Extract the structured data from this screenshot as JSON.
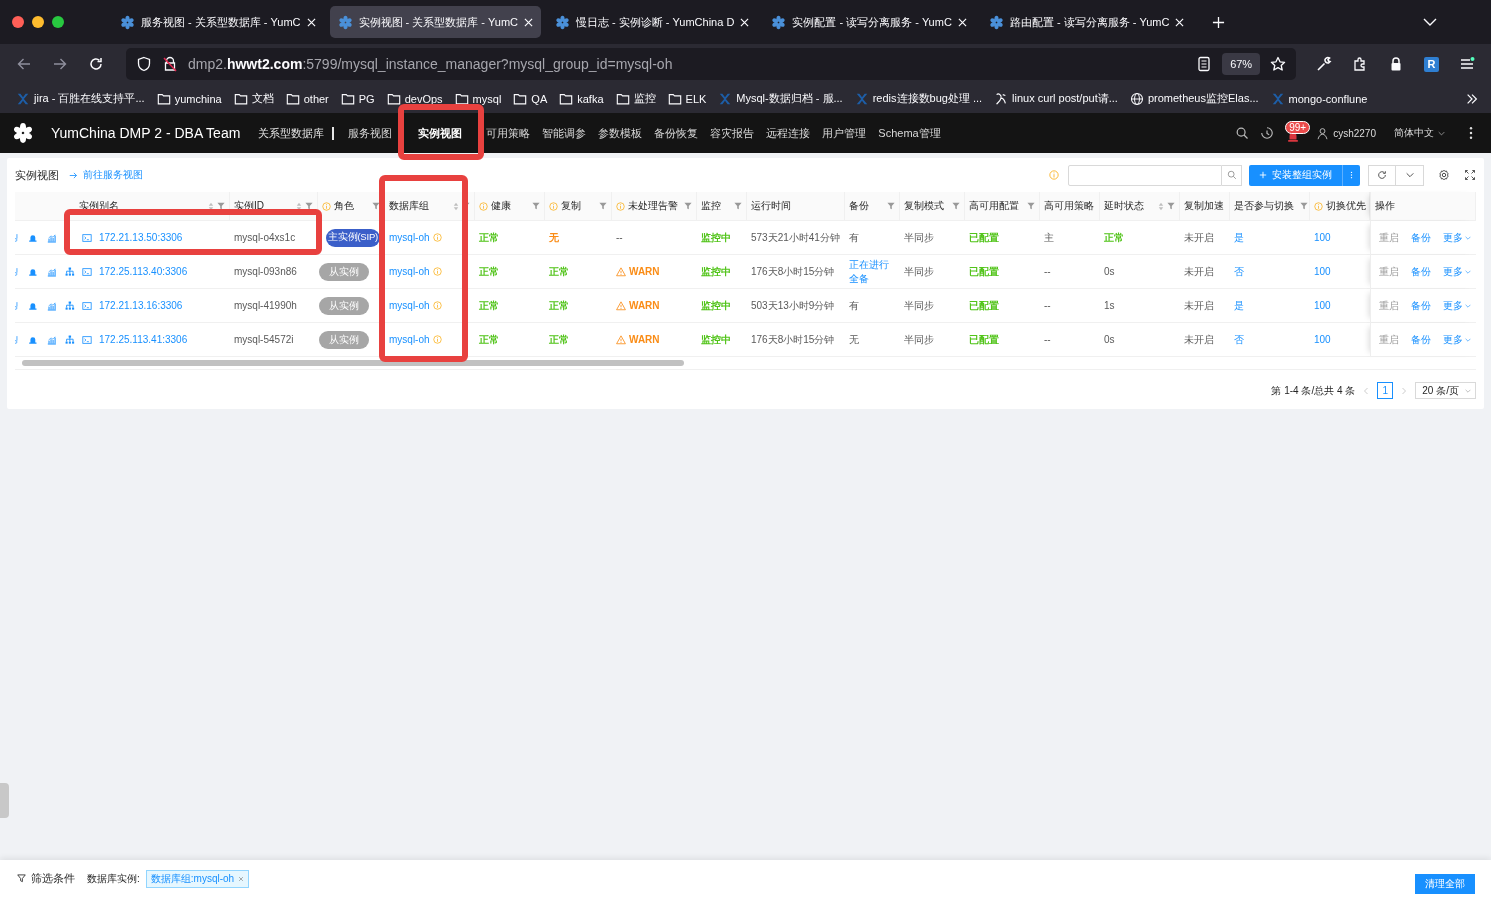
{
  "browser": {
    "tabs": [
      {
        "title": "服务视图 - 关系型数据库 - YumC",
        "selected": false
      },
      {
        "title": "实例视图 - 关系型数据库 - YumC",
        "selected": true
      },
      {
        "title": "慢日志 - 实例诊断 - YumChina D",
        "selected": false
      },
      {
        "title": "实例配置 - 读写分离服务 - YumC",
        "selected": false
      },
      {
        "title": "路由配置 - 读写分离服务 - YumC",
        "selected": false
      }
    ],
    "url": "dmp2.**hwwt2.com**:5799/mysql_instance_manager?mysql_group_id=mysql-oh",
    "zoom": "67%",
    "profile": "R",
    "bookmarks": [
      {
        "label": "jira - 百胜在线支持平...",
        "kind": "site"
      },
      {
        "label": "yumchina",
        "kind": "folder"
      },
      {
        "label": "文档",
        "kind": "folder"
      },
      {
        "label": "other",
        "kind": "folder"
      },
      {
        "label": "PG",
        "kind": "folder"
      },
      {
        "label": "devOps",
        "kind": "folder"
      },
      {
        "label": "mysql",
        "kind": "folder"
      },
      {
        "label": "QA",
        "kind": "folder"
      },
      {
        "label": "kafka",
        "kind": "folder"
      },
      {
        "label": "监控",
        "kind": "folder"
      },
      {
        "label": "ELK",
        "kind": "folder"
      },
      {
        "label": "Mysql-数据归档 - 服...",
        "kind": "site"
      },
      {
        "label": "redis连接数bug处理 ...",
        "kind": "site"
      },
      {
        "label": "linux curl post/put请...",
        "kind": "script"
      },
      {
        "label": "prometheus监控Elas...",
        "kind": "globe"
      },
      {
        "label": "mongo-conflune",
        "kind": "site"
      }
    ]
  },
  "app": {
    "title": "YumChina DMP 2 - DBA Team",
    "section": "关系型数据库",
    "nav": [
      {
        "label": "服务视图",
        "selected": false
      },
      {
        "label": "实例视图",
        "selected": true
      },
      {
        "label": "可用策略",
        "selected": false
      },
      {
        "label": "智能调参",
        "selected": false
      },
      {
        "label": "参数模板",
        "selected": false
      },
      {
        "label": "备份恢复",
        "selected": false
      },
      {
        "label": "容灾报告",
        "selected": false
      },
      {
        "label": "远程连接",
        "selected": false
      },
      {
        "label": "用户管理",
        "selected": false
      },
      {
        "label": "Schema管理",
        "selected": false
      }
    ],
    "notification_count": "99+",
    "user": "cysh2270",
    "language": "简体中文"
  },
  "page": {
    "title": "实例视图",
    "link": "前往服务视图",
    "primary_action": "安装整组实例"
  },
  "table": {
    "columns": [
      {
        "label": "实例别名",
        "sort": true,
        "filter": true,
        "info": false
      },
      {
        "label": "实例ID",
        "sort": true,
        "filter": true,
        "info": false
      },
      {
        "label": "角色",
        "sort": false,
        "filter": true,
        "info": true
      },
      {
        "label": "数据库组",
        "sort": true,
        "filter": true,
        "info": false
      },
      {
        "label": "健康",
        "sort": false,
        "filter": true,
        "info": true
      },
      {
        "label": "复制",
        "sort": false,
        "filter": true,
        "info": true
      },
      {
        "label": "未处理告警",
        "sort": false,
        "filter": true,
        "info": true
      },
      {
        "label": "监控",
        "sort": false,
        "filter": true,
        "info": false
      },
      {
        "label": "运行时间",
        "sort": false,
        "filter": false,
        "info": false
      },
      {
        "label": "备份",
        "sort": false,
        "filter": true,
        "info": false
      },
      {
        "label": "复制模式",
        "sort": false,
        "filter": true,
        "info": false
      },
      {
        "label": "高可用配置",
        "sort": false,
        "filter": true,
        "info": false
      },
      {
        "label": "高可用策略",
        "sort": false,
        "filter": false,
        "info": false
      },
      {
        "label": "延时状态",
        "sort": true,
        "filter": true,
        "info": false
      },
      {
        "label": "复制加速",
        "sort": false,
        "filter": false,
        "info": false
      },
      {
        "label": "是否参与切换",
        "sort": false,
        "filter": true,
        "info": false
      },
      {
        "label": "切换优先",
        "sort": false,
        "filter": false,
        "info": true
      },
      {
        "label": "操作",
        "sort": false,
        "filter": false,
        "info": false
      }
    ],
    "rows": [
      {
        "topology": false,
        "cells": [
          {
            "text": "172.21.13.50:3306",
            "kind": "address"
          },
          {
            "text": "mysql-o4xs1c",
            "kind": "plain"
          },
          {
            "text": "主实例(SIP)",
            "kind": "primary_role"
          },
          {
            "text": "mysql-oh",
            "kind": "group"
          },
          {
            "text": "正常",
            "kind": "ok"
          },
          {
            "text": "无",
            "kind": "warn"
          },
          {
            "text": "--",
            "kind": "plain"
          },
          {
            "text": "监控中",
            "kind": "ok"
          },
          {
            "text": "573天21小时41分钟",
            "kind": "plain"
          },
          {
            "text": "有",
            "kind": "plain"
          },
          {
            "text": "半同步",
            "kind": "plain"
          },
          {
            "text": "已配置",
            "kind": "ok"
          },
          {
            "text": "主",
            "kind": "plain"
          },
          {
            "text": "正常",
            "kind": "ok"
          },
          {
            "text": "未开启",
            "kind": "plain"
          },
          {
            "text": "是",
            "kind": "link"
          },
          {
            "text": "100",
            "kind": "link"
          }
        ],
        "actions": [
          {
            "label": "重启",
            "disabled": true,
            "menu": false
          },
          {
            "label": "备份",
            "disabled": false,
            "menu": false
          },
          {
            "label": "更多",
            "disabled": false,
            "menu": true
          }
        ]
      },
      {
        "topology": true,
        "cells": [
          {
            "text": "172.25.113.40:3306",
            "kind": "address"
          },
          {
            "text": "mysql-093n86",
            "kind": "plain"
          },
          {
            "text": "从实例",
            "kind": "role"
          },
          {
            "text": "mysql-oh",
            "kind": "group"
          },
          {
            "text": "正常",
            "kind": "ok"
          },
          {
            "text": "正常",
            "kind": "ok"
          },
          {
            "text": "WARN",
            "kind": "alert"
          },
          {
            "text": "监控中",
            "kind": "ok"
          },
          {
            "text": "176天8小时15分钟",
            "kind": "plain"
          },
          {
            "text": "正在进行全备",
            "kind": "link"
          },
          {
            "text": "半同步",
            "kind": "plain"
          },
          {
            "text": "已配置",
            "kind": "ok"
          },
          {
            "text": "--",
            "kind": "plain"
          },
          {
            "text": "0s",
            "kind": "plain"
          },
          {
            "text": "未开启",
            "kind": "plain"
          },
          {
            "text": "否",
            "kind": "link"
          },
          {
            "text": "100",
            "kind": "link"
          }
        ],
        "actions": [
          {
            "label": "重启",
            "disabled": true,
            "menu": false
          },
          {
            "label": "备份",
            "disabled": false,
            "menu": false
          },
          {
            "label": "更多",
            "disabled": false,
            "menu": true
          }
        ]
      },
      {
        "topology": true,
        "cells": [
          {
            "text": "172.21.13.16:3306",
            "kind": "address"
          },
          {
            "text": "mysql-41990h",
            "kind": "plain"
          },
          {
            "text": "从实例",
            "kind": "role"
          },
          {
            "text": "mysql-oh",
            "kind": "group"
          },
          {
            "text": "正常",
            "kind": "ok"
          },
          {
            "text": "正常",
            "kind": "ok"
          },
          {
            "text": "WARN",
            "kind": "alert"
          },
          {
            "text": "监控中",
            "kind": "ok"
          },
          {
            "text": "503天13小时9分钟",
            "kind": "plain"
          },
          {
            "text": "有",
            "kind": "plain"
          },
          {
            "text": "半同步",
            "kind": "plain"
          },
          {
            "text": "已配置",
            "kind": "ok"
          },
          {
            "text": "--",
            "kind": "plain"
          },
          {
            "text": "1s",
            "kind": "plain"
          },
          {
            "text": "未开启",
            "kind": "plain"
          },
          {
            "text": "是",
            "kind": "link"
          },
          {
            "text": "100",
            "kind": "link"
          }
        ],
        "actions": [
          {
            "label": "重启",
            "disabled": true,
            "menu": false
          },
          {
            "label": "备份",
            "disabled": false,
            "menu": false
          },
          {
            "label": "更多",
            "disabled": false,
            "menu": true
          }
        ]
      },
      {
        "topology": true,
        "cells": [
          {
            "text": "172.25.113.41:3306",
            "kind": "address"
          },
          {
            "text": "mysql-54572i",
            "kind": "plain"
          },
          {
            "text": "从实例",
            "kind": "role"
          },
          {
            "text": "mysql-oh",
            "kind": "group"
          },
          {
            "text": "正常",
            "kind": "ok"
          },
          {
            "text": "正常",
            "kind": "ok"
          },
          {
            "text": "WARN",
            "kind": "alert"
          },
          {
            "text": "监控中",
            "kind": "ok"
          },
          {
            "text": "176天8小时15分钟",
            "kind": "plain"
          },
          {
            "text": "无",
            "kind": "plain"
          },
          {
            "text": "半同步",
            "kind": "plain"
          },
          {
            "text": "已配置",
            "kind": "ok"
          },
          {
            "text": "--",
            "kind": "plain"
          },
          {
            "text": "0s",
            "kind": "plain"
          },
          {
            "text": "未开启",
            "kind": "plain"
          },
          {
            "text": "否",
            "kind": "link"
          },
          {
            "text": "100",
            "kind": "link"
          }
        ],
        "actions": [
          {
            "label": "重启",
            "disabled": true,
            "menu": false
          },
          {
            "label": "备份",
            "disabled": false,
            "menu": false
          },
          {
            "label": "更多",
            "disabled": false,
            "menu": true
          }
        ]
      }
    ]
  },
  "pagination": {
    "summary": "第 1-4 条/总共 4 条",
    "pages": [
      {
        "label": "1",
        "selected": true
      }
    ],
    "page_size": "20 条/页"
  },
  "filter_bar": {
    "title": "筛选条件",
    "label": "数据库实例:",
    "tags": [
      "数据库组:mysql-oh"
    ],
    "clear": "清理全部"
  }
}
